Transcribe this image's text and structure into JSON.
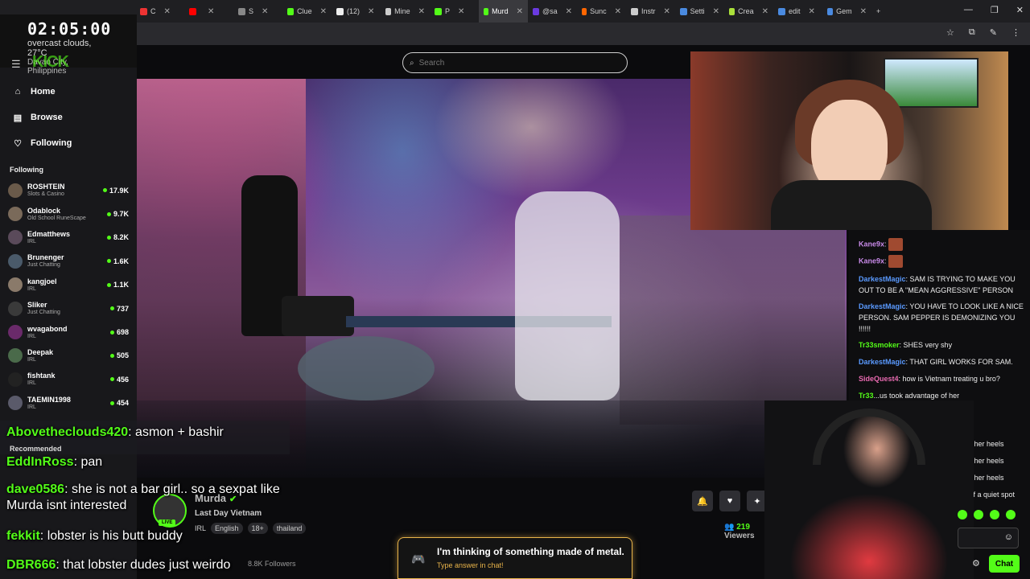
{
  "browser": {
    "tabs": [
      {
        "label": "C",
        "color": "#e33"
      },
      {
        "label": "",
        "color": "#f00"
      },
      {
        "label": "S",
        "color": "#888"
      },
      {
        "label": "Clue",
        "color": "#53fc18"
      },
      {
        "label": "(12)",
        "color": "#eee"
      },
      {
        "label": "Mine",
        "color": "#ccc"
      },
      {
        "label": "P",
        "color": "#53fc18"
      },
      {
        "label": "Murd",
        "color": "#53fc18",
        "active": true
      },
      {
        "label": "@sa",
        "color": "#6a3ae0"
      },
      {
        "label": "Sunc",
        "color": "#f60"
      },
      {
        "label": "Instr",
        "color": "#ccc"
      },
      {
        "label": "Setti",
        "color": "#4a8ae0"
      },
      {
        "label": "Crea",
        "color": "#aae03a"
      },
      {
        "label": "edit",
        "color": "#4a8ae0"
      },
      {
        "label": "Gem",
        "color": "#4a8ae0"
      }
    ],
    "new_tab": "+",
    "window_controls": [
      "—",
      "❐",
      "✕"
    ]
  },
  "clock": {
    "time": "02:05:00",
    "weather": "overcast clouds, 27°C",
    "location": "Davao City, Philippines"
  },
  "logo": "KICK",
  "search": {
    "placeholder": "Search"
  },
  "nav": [
    {
      "label": "Home",
      "icon": "home-icon",
      "glyph": "⌂"
    },
    {
      "label": "Browse",
      "icon": "browse-icon",
      "glyph": "▤"
    },
    {
      "label": "Following",
      "icon": "heart-icon",
      "glyph": "♡"
    }
  ],
  "following_header": "Following",
  "following": [
    {
      "name": "ROSHTEIN",
      "game": "Slots & Casino",
      "viewers": "17.9K"
    },
    {
      "name": "Odablock",
      "game": "Old School RuneScape",
      "viewers": "9.7K"
    },
    {
      "name": "Edmatthews",
      "game": "IRL",
      "viewers": "8.2K"
    },
    {
      "name": "Brunenger",
      "game": "Just Chatting",
      "viewers": "1.6K"
    },
    {
      "name": "kangjoel",
      "game": "IRL",
      "viewers": "1.1K"
    },
    {
      "name": "Sliker",
      "game": "Just Chatting",
      "viewers": "737"
    },
    {
      "name": "wvagabond",
      "game": "IRL",
      "viewers": "698"
    },
    {
      "name": "Deepak",
      "game": "IRL",
      "viewers": "505"
    },
    {
      "name": "fishtank",
      "game": "IRL",
      "viewers": "456"
    },
    {
      "name": "TAEMIN1998",
      "game": "IRL",
      "viewers": "454"
    }
  ],
  "recommended_label": "Recommended",
  "overlay_chat": [
    {
      "user": "Abovetheclouds420",
      "msg": ": asmon + bashir"
    },
    {
      "user": "EddInRoss",
      "msg": ": pan"
    },
    {
      "user": "dave0586",
      "msg": ": she is not a bar girl.. so a sexpat like Murda isnt interested"
    },
    {
      "user": "fekkit",
      "msg": ": lobster is his butt buddy"
    },
    {
      "user": "DBR666",
      "msg": ": that lobster dudes just weirdo"
    }
  ],
  "stream": {
    "name": "Murda",
    "title": "Last Day Vietnam",
    "live": "LIVE",
    "category": "IRL",
    "tags": [
      "English",
      "18+",
      "thailand"
    ],
    "viewers_count": "219",
    "viewers_label": "Viewers",
    "followers": "8.8K Followers"
  },
  "chat": [
    {
      "user": "Kane9x",
      "msg": ":",
      "color": "#c88ae8",
      "emote": true
    },
    {
      "user": "Kane9x",
      "msg": ":",
      "color": "#c88ae8",
      "emote": true
    },
    {
      "user": "DarkestMagic",
      "msg": ": SAM IS TRYING TO MAKE YOU OUT TO BE A \"MEAN AGGRESSIVE\" PERSON",
      "color": "#5a9aff"
    },
    {
      "user": "DarkestMagic",
      "msg": ": YOU HAVE TO LOOK LIKE A NICE PERSON. SAM PEPPER IS DEMONIZING YOU !!!!!!",
      "color": "#5a9aff"
    },
    {
      "user": "Tr33smoker",
      "msg": ": SHES very shy",
      "color": "#53fc18"
    },
    {
      "user": "DarkestMagic",
      "msg": ": THAT GIRL WORKS FOR SAM.",
      "color": "#5a9aff"
    },
    {
      "user": "SideQuest4",
      "msg": ": how is Vietnam treating u bro?",
      "color": "#e86ab0"
    },
    {
      "user": "Tr33",
      "msg": "...us took advantage of her",
      "color": "#53fc18"
    },
    {
      "user": "",
      "msg": "u kiss her heels",
      "color": "#eee"
    },
    {
      "user": "",
      "msg": "u kiss her heels",
      "color": "#eee"
    },
    {
      "user": "",
      "msg": "u kiss her heels",
      "color": "#eee"
    },
    {
      "user": "",
      "msg": "a bit of a quiet spot",
      "color": "#eee"
    }
  ],
  "chat_button": "Chat",
  "guess_banner": {
    "question": "I'm thinking of something made of metal.",
    "hint": "Type answer in chat!"
  },
  "colors": {
    "accent": "#53fc18",
    "gold": "#e9b44a"
  }
}
